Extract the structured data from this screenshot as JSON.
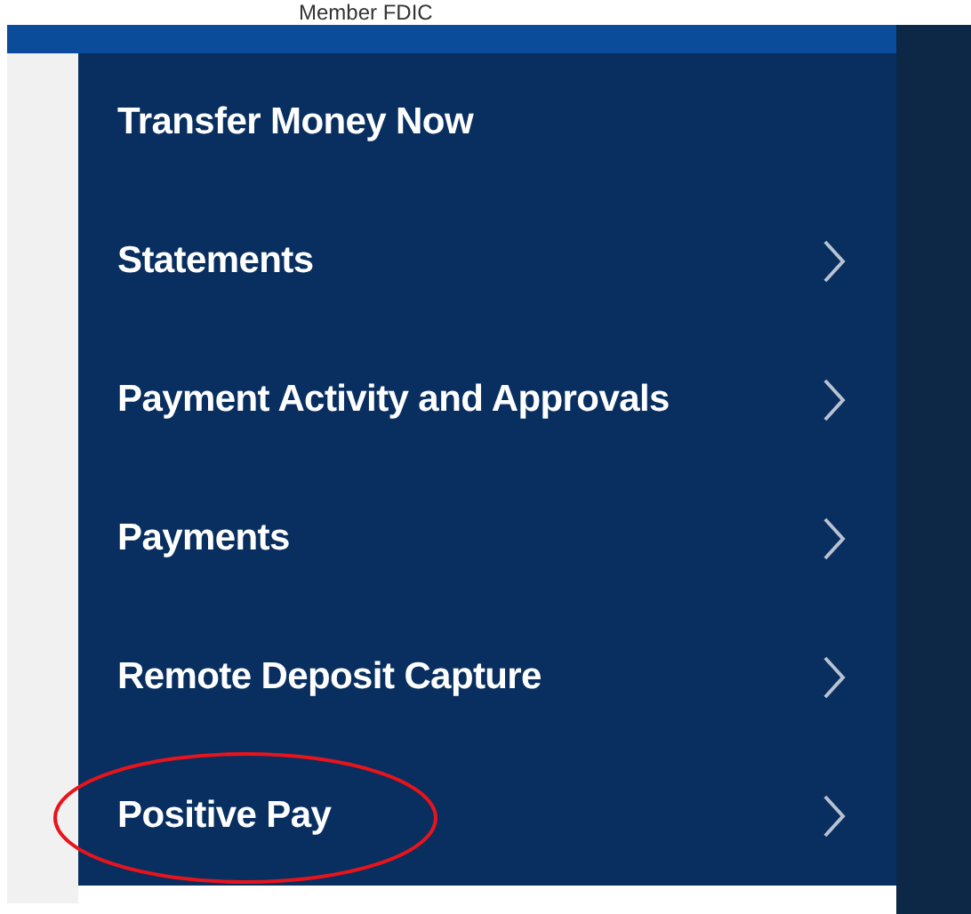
{
  "header": {
    "member_text": "Member FDIC"
  },
  "menu": {
    "items": [
      {
        "label": "Transfer Money Now",
        "has_submenu": false,
        "circled": false
      },
      {
        "label": "Statements",
        "has_submenu": true,
        "circled": false
      },
      {
        "label": "Payment Activity and Approvals",
        "has_submenu": true,
        "circled": false
      },
      {
        "label": "Payments",
        "has_submenu": true,
        "circled": false
      },
      {
        "label": "Remote Deposit Capture",
        "has_submenu": true,
        "circled": false
      },
      {
        "label": "Positive Pay",
        "has_submenu": true,
        "circled": true
      }
    ]
  }
}
